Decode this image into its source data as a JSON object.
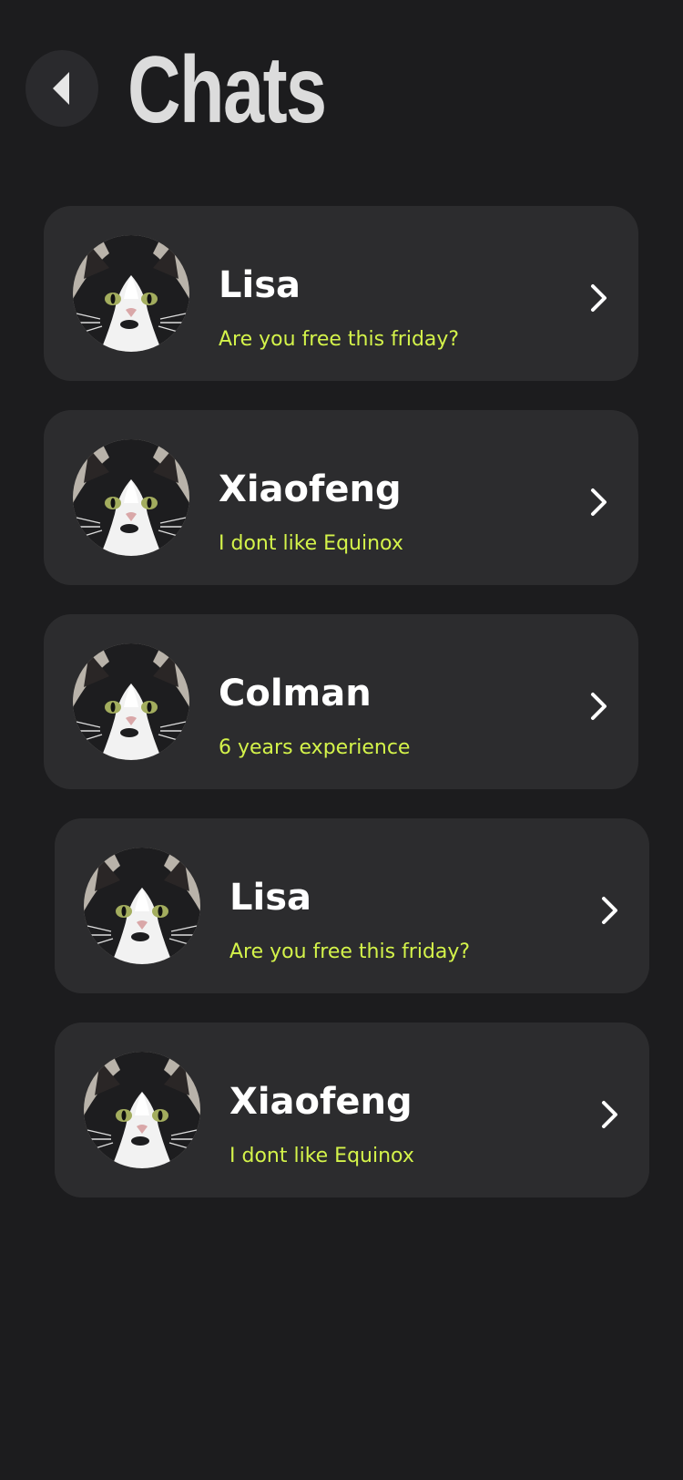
{
  "header": {
    "title": "Chats",
    "back_icon": "caret-left-icon"
  },
  "colors": {
    "background": "#1c1c1e",
    "card": "#2c2c2e",
    "name": "#ffffff",
    "preview": "#d4f34a",
    "title": "#dcdcdc"
  },
  "chats": [
    {
      "name": "Lisa",
      "preview": "Are you free this friday?",
      "avatar": "cat-avatar",
      "icon": "chevron-right-icon"
    },
    {
      "name": "Xiaofeng",
      "preview": "I dont like Equinox",
      "avatar": "cat-avatar",
      "icon": "chevron-right-icon"
    },
    {
      "name": "Colman",
      "preview": "6 years experience",
      "avatar": "cat-avatar",
      "icon": "chevron-right-icon"
    },
    {
      "name": "Lisa",
      "preview": "Are you free this friday?",
      "avatar": "cat-avatar",
      "icon": "chevron-right-icon"
    },
    {
      "name": "Xiaofeng",
      "preview": "I dont like Equinox",
      "avatar": "cat-avatar",
      "icon": "chevron-right-icon"
    }
  ]
}
